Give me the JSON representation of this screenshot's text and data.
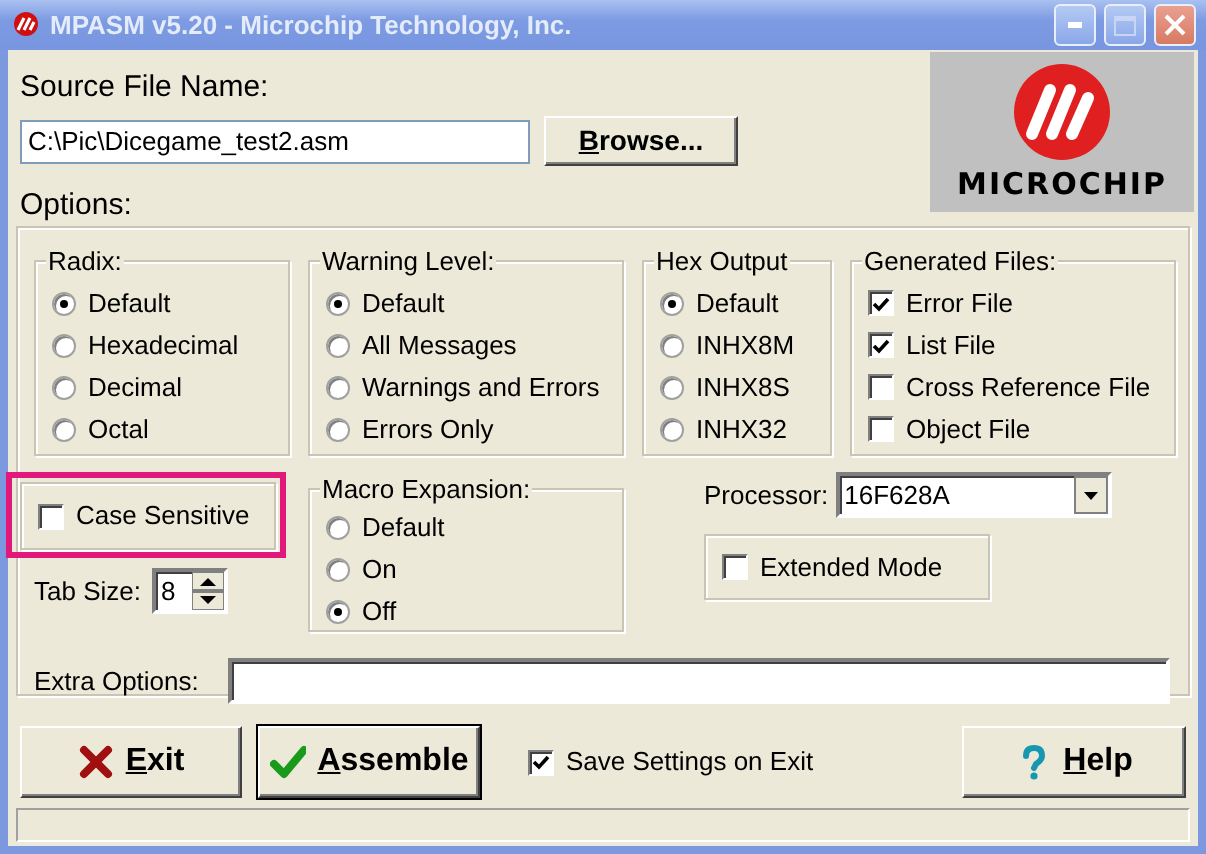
{
  "window": {
    "title": "MPASM v5.20 - Microchip Technology, Inc."
  },
  "source_file": {
    "label": "Source File Name:",
    "value": "C:\\Pic\\Dicegame_test2.asm"
  },
  "browse_button": {
    "label": "Browse..."
  },
  "logo": {
    "text": "MICROCHIP"
  },
  "options_label": "Options:",
  "groups": [
    {
      "title": "Radix:",
      "kind": "radio",
      "options": [
        {
          "label": "Default",
          "selected": true
        },
        {
          "label": "Hexadecimal",
          "selected": false
        },
        {
          "label": "Decimal",
          "selected": false
        },
        {
          "label": "Octal",
          "selected": false
        }
      ]
    },
    {
      "title": "Warning Level:",
      "kind": "radio",
      "options": [
        {
          "label": "Default",
          "selected": true
        },
        {
          "label": "All Messages",
          "selected": false
        },
        {
          "label": "Warnings and Errors",
          "selected": false
        },
        {
          "label": "Errors Only",
          "selected": false
        }
      ]
    },
    {
      "title": "Hex Output",
      "kind": "radio",
      "options": [
        {
          "label": "Default",
          "selected": true
        },
        {
          "label": "INHX8M",
          "selected": false
        },
        {
          "label": "INHX8S",
          "selected": false
        },
        {
          "label": "INHX32",
          "selected": false
        }
      ]
    },
    {
      "title": "Generated Files:",
      "kind": "checkbox",
      "options": [
        {
          "label": "Error File",
          "checked": true
        },
        {
          "label": "List File",
          "checked": true
        },
        {
          "label": "Cross Reference File",
          "checked": false
        },
        {
          "label": "Object File",
          "checked": false
        }
      ]
    }
  ],
  "case_sensitive": {
    "label": "Case Sensitive",
    "checked": false,
    "highlighted": true
  },
  "tab_size": {
    "label": "Tab Size:",
    "value": "8"
  },
  "macro_expansion": {
    "title": "Macro Expansion:",
    "options": [
      {
        "label": "Default",
        "selected": false
      },
      {
        "label": "On",
        "selected": false
      },
      {
        "label": "Off",
        "selected": true
      }
    ]
  },
  "processor": {
    "label": "Processor:",
    "value": "16F628A"
  },
  "extended_mode": {
    "label": "Extended Mode",
    "checked": false
  },
  "extra_options": {
    "label": "Extra Options:"
  },
  "buttons": [
    {
      "label": "Exit",
      "kind": "exit",
      "default": false
    },
    {
      "label": "Assemble",
      "kind": "assemble",
      "default": true
    }
  ],
  "save_settings": {
    "label": "Save Settings on Exit",
    "checked": true
  },
  "help_button": {
    "label": "Help",
    "kind": "help",
    "default": false
  }
}
